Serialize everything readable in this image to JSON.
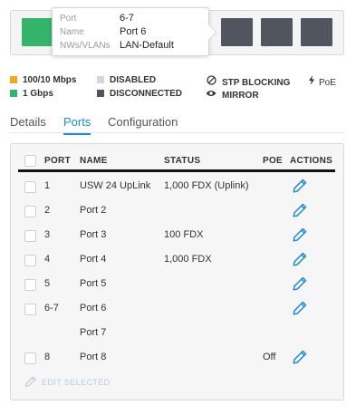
{
  "switch_panel": {
    "port_colors": [
      "#35b36a",
      "#505560",
      "#505560",
      "#505560"
    ]
  },
  "tooltip": {
    "rows": [
      {
        "key": "Port",
        "value": "6-7"
      },
      {
        "key": "Name",
        "value": "Port 6"
      },
      {
        "key": "NWs/VLANs",
        "value": "LAN-Default"
      }
    ]
  },
  "legend": {
    "speed_100_10": "100/10 Mbps",
    "speed_1g": "1 Gbps",
    "disabled": "DISABLED",
    "disconnected": "DISCONNECTED",
    "stp_blocking": "STP BLOCKING",
    "mirror": "MIRROR",
    "poe": "PoE",
    "colors": {
      "speed_100_10": "#f5a623",
      "speed_1g": "#35b36a",
      "disabled": "#d6d6d6",
      "disconnected": "#505560"
    }
  },
  "tabs": [
    {
      "label": "Details",
      "active": false
    },
    {
      "label": "Ports",
      "active": true
    },
    {
      "label": "Configuration",
      "active": false
    }
  ],
  "table": {
    "headers": {
      "port": "PORT",
      "name": "NAME",
      "status": "STATUS",
      "poe": "POE",
      "actions": "ACTIONS"
    },
    "rows": [
      {
        "port": "1",
        "name": "USW 24 UpLink",
        "status": "1,000 FDX (Uplink)",
        "poe": "",
        "checkbox": true,
        "edit": true
      },
      {
        "port": "2",
        "name": "Port 2",
        "status": "",
        "poe": "",
        "checkbox": true,
        "edit": true
      },
      {
        "port": "3",
        "name": "Port 3",
        "status": "100 FDX",
        "poe": "",
        "checkbox": true,
        "edit": true
      },
      {
        "port": "4",
        "name": "Port 4",
        "status": "1,000 FDX",
        "poe": "",
        "checkbox": true,
        "edit": true
      },
      {
        "port": "5",
        "name": "Port 5",
        "status": "",
        "poe": "",
        "checkbox": true,
        "edit": true
      },
      {
        "port": "6-7",
        "name": "Port 6",
        "status": "",
        "poe": "",
        "checkbox": true,
        "edit": true
      },
      {
        "port": "",
        "name": "Port 7",
        "status": "",
        "poe": "",
        "checkbox": false,
        "edit": false
      },
      {
        "port": "8",
        "name": "Port 8",
        "status": "",
        "poe": "Off",
        "checkbox": true,
        "edit": true
      }
    ],
    "edit_selected_label": "EDIT SELECTED"
  },
  "accent_color": "#1d8ad3"
}
